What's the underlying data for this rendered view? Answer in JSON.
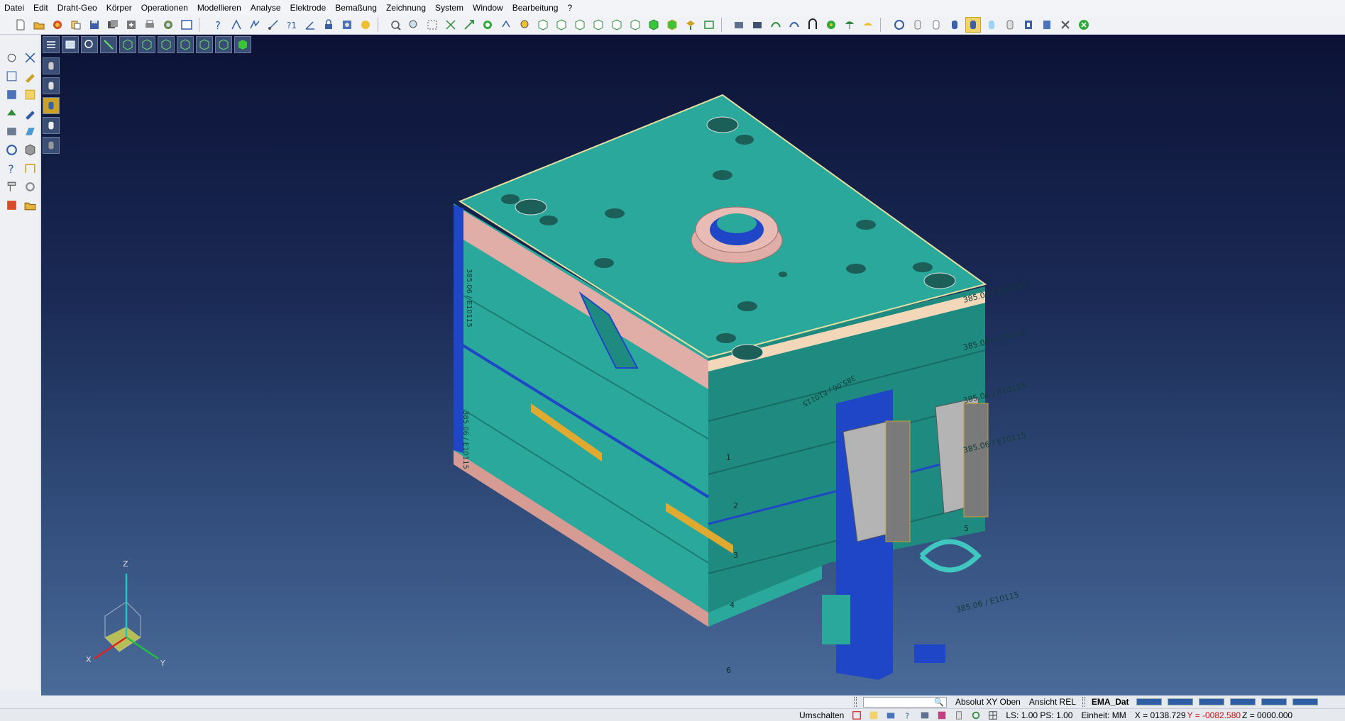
{
  "menu": {
    "items": [
      "Datei",
      "Edit",
      "Draht-Geo",
      "Körper",
      "Operationen",
      "Modellieren",
      "Analyse",
      "Elektrode",
      "Bemaßung",
      "Zeichnung",
      "System",
      "Window",
      "Bearbeitung",
      "?"
    ]
  },
  "model": {
    "labels": {
      "top_front": "385.06 / E10115",
      "top_side": "385.06 / E10115",
      "plate1": "385.06 / E10115",
      "plate2": "385.06 / E10115",
      "plate3": "385.06 / E10115",
      "plate5": "385.06 / E10115",
      "left_top": "385.06 / E10115",
      "left_mid": "385.06 / E10115"
    },
    "plate_numbers": [
      "1",
      "2",
      "3",
      "4",
      "5",
      "6"
    ],
    "colors": {
      "teal": "#2aa89b",
      "teal_dark": "#1f8a80",
      "pink": "#e0aea6",
      "blue": "#2046c8",
      "grey": "#b4b4b4"
    }
  },
  "triad": {
    "x": "X",
    "y": "Y",
    "z": "Z"
  },
  "status": {
    "view": "Absolut XY Oben",
    "ansicht": "Ansicht REL",
    "file": "EMA_Dat",
    "umschalten": "Umschalten",
    "ls_ps": "LS: 1.00 PS: 1.00",
    "einheit": "Einheit: MM",
    "x": "X = 0138.729",
    "y": "Y = -0082.580",
    "z": "Z = 0000.000"
  }
}
